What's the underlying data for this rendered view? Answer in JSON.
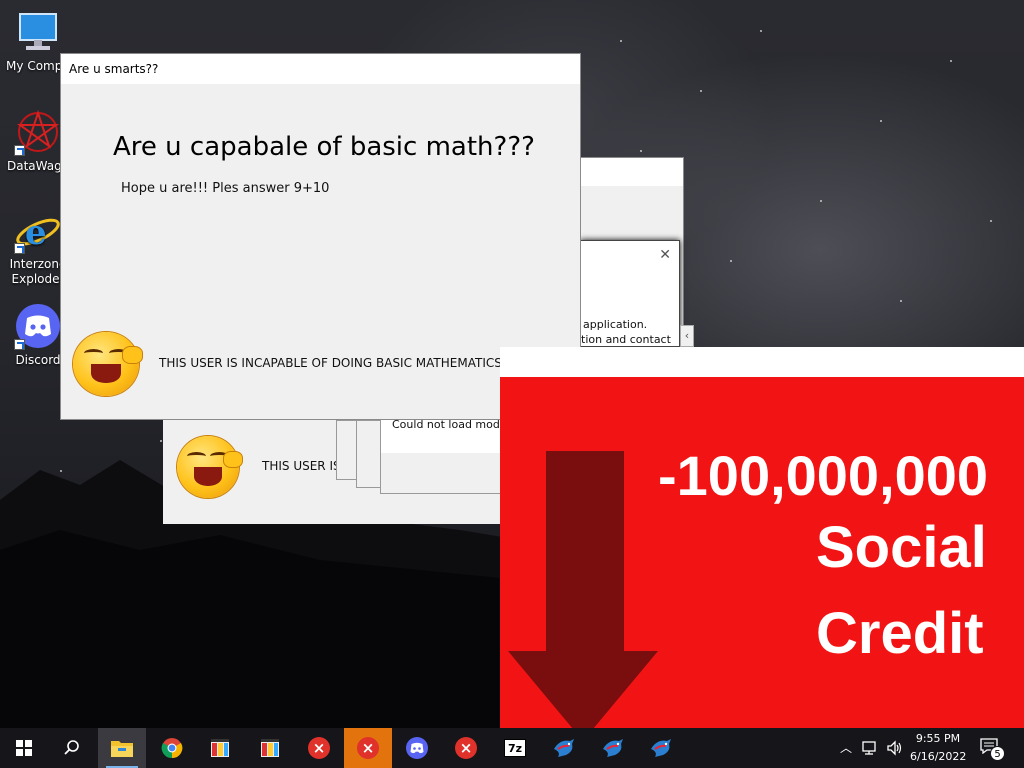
{
  "desktop": {
    "icons": [
      {
        "label": "My Compu",
        "icon": "monitor-icon"
      },
      {
        "label": "DataWago",
        "icon": "pentagram-icon"
      },
      {
        "label": "Interzone\nExploder",
        "icon": "internet-explorer-icon"
      },
      {
        "label": "Discord",
        "icon": "discord-icon"
      }
    ]
  },
  "front_window": {
    "title": "Are u smarts??",
    "heading": "Are u capabale of basic math???",
    "subtext": "Hope u are!!! Ples answer 9+10",
    "bottom_message": "THIS USER IS INCAPABLE OF DOING BASIC MATHEMATICS LMAO"
  },
  "back_window": {
    "bottom_message": "THIS USER IS I"
  },
  "error_dialog": {
    "text_line1": "application.",
    "text_line2": "tion and contact",
    "close_glyph": "✕"
  },
  "module_dialog": {
    "text": "Could not load modu"
  },
  "credit_panel": {
    "amount": "-100,000,000",
    "line2": "Social",
    "line3": "Credit",
    "bg_color": "#f21414",
    "arrow_color": "#7a0d0d"
  },
  "taskbar": {
    "apps": [
      {
        "name": "start",
        "icon": "windows-logo-icon"
      },
      {
        "name": "search",
        "icon": "search-icon"
      },
      {
        "name": "file-explorer",
        "icon": "folder-icon"
      },
      {
        "name": "chrome",
        "icon": "chrome-icon"
      },
      {
        "name": "app-window-1",
        "icon": "colorful-window-icon"
      },
      {
        "name": "app-window-2",
        "icon": "colorful-window-icon"
      },
      {
        "name": "error-1",
        "icon": "error-icon"
      },
      {
        "name": "error-2",
        "icon": "error-icon"
      },
      {
        "name": "discord",
        "icon": "discord-icon"
      },
      {
        "name": "error-3",
        "icon": "error-icon"
      },
      {
        "name": "7zip",
        "icon": "7zip-icon",
        "label": "7z"
      },
      {
        "name": "app-bird-1",
        "icon": "bird-icon"
      },
      {
        "name": "app-bird-2",
        "icon": "bird-icon"
      },
      {
        "name": "app-bird-3",
        "icon": "bird-icon"
      }
    ],
    "tray": {
      "time": "9:55 PM",
      "date": "6/16/2022",
      "notification_count": "5"
    }
  }
}
